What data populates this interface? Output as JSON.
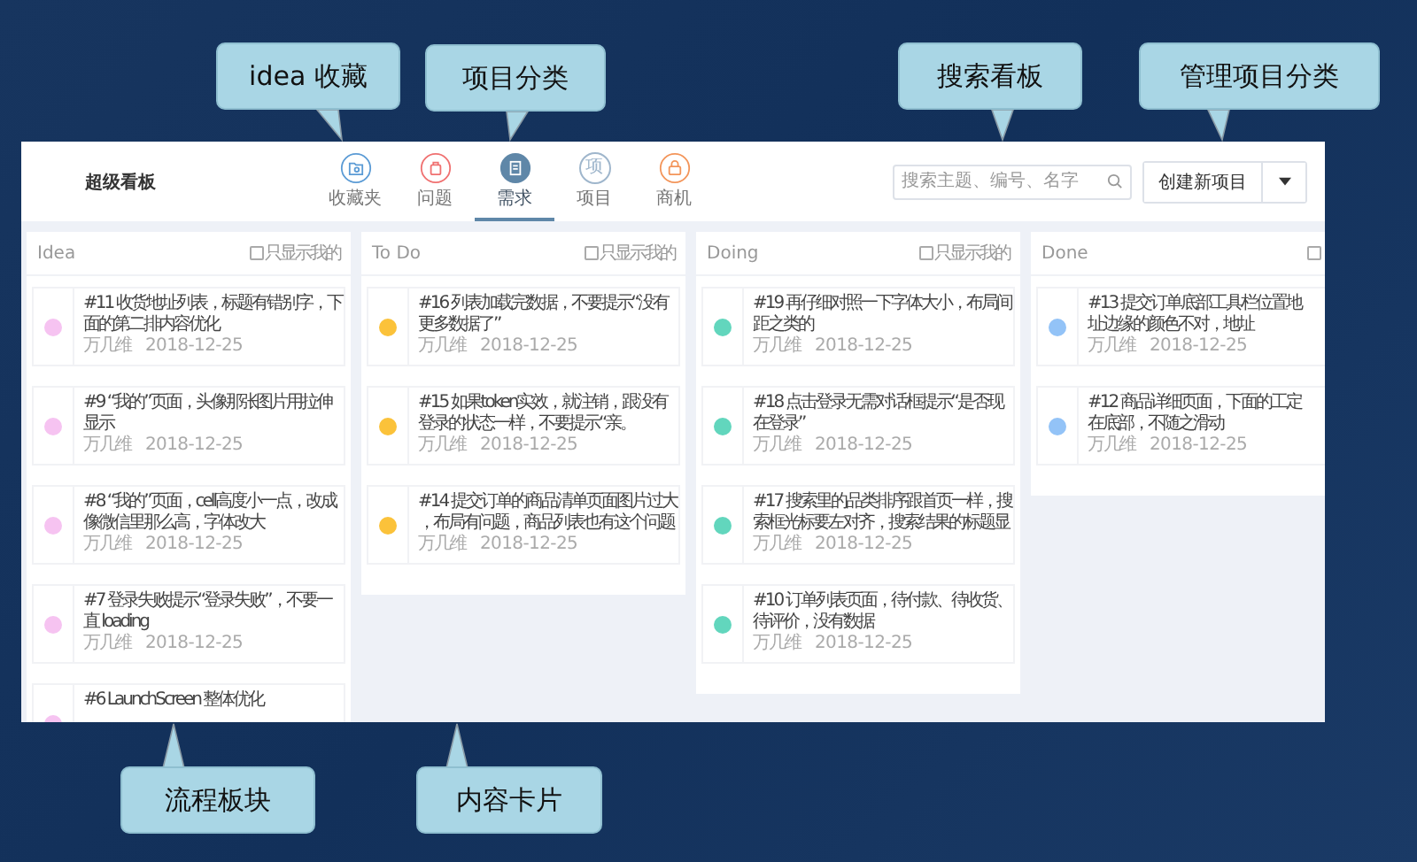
{
  "app": {
    "title": "超级看板",
    "tabs": [
      {
        "label": "收藏夹",
        "kind": "folder",
        "color": "#5b9bd5",
        "selected": false
      },
      {
        "label": "问题",
        "kind": "bag",
        "color": "#f07070",
        "selected": false
      },
      {
        "label": "需求",
        "kind": "doc",
        "color": "#5f87a8",
        "selected": true
      },
      {
        "label": "项目",
        "kind": "glyph",
        "glyph": "项",
        "color": "#9fb6cc",
        "selected": false
      },
      {
        "label": "商机",
        "kind": "lock",
        "color": "#f3955a",
        "selected": false
      }
    ],
    "search": {
      "placeholder": "搜索主题、编号、名字"
    },
    "create_button": "创建新项目"
  },
  "columns": [
    {
      "name": "Idea",
      "filter_label": "只显示我的",
      "filter_checked": false,
      "cards": [
        {
          "color": "#f6c3f1",
          "title": "#11 收货地址列表，标题有错别字，下面的第二排内容优化",
          "author": "万几维",
          "date": "2018-12-25"
        },
        {
          "color": "#f6c3f1",
          "title": "#9 “我的”页面，头像那张图片用拉伸显示",
          "author": "万几维",
          "date": "2018-12-25"
        },
        {
          "color": "#f6c3f1",
          "title": "#8 “我的”页面，cell高度小一点，改成像微信里那么高，字体改大",
          "author": "万几维",
          "date": "2018-12-25"
        },
        {
          "color": "#f6c3f1",
          "title": "#7 登录失败提示“登录失败”，不要一直 loading",
          "author": "万几维",
          "date": "2018-12-25"
        },
        {
          "color": "#f6c3f1",
          "title": "#6 LaunchScreen 整体优化"
        }
      ]
    },
    {
      "name": "To Do",
      "filter_label": "只显示我的",
      "filter_checked": false,
      "cards": [
        {
          "color": "#fbc23a",
          "title": "#16 列表加载完数据，不要提示“没有更多数据了”",
          "author": "万几维",
          "date": "2018-12-25"
        },
        {
          "color": "#fbc23a",
          "title": "#15 如果token实效，就注销，跟没有登录的状态一样，不要提示“亲。",
          "author": "万几维",
          "date": "2018-12-25"
        },
        {
          "color": "#fbc23a",
          "title": "#14 提交订单的商品清单页面图片过大，布局有问题，商品列表也有这个问题",
          "author": "万几维",
          "date": "2018-12-25"
        }
      ]
    },
    {
      "name": "Doing",
      "filter_label": "只显示我的",
      "filter_checked": false,
      "cards": [
        {
          "color": "#62d6bd",
          "title": "#19 再仔细对照一下字体大小，布局间距之类的",
          "author": "万几维",
          "date": "2018-12-25"
        },
        {
          "color": "#62d6bd",
          "title": "#18 点击登录无需对话框提示“是否现在登录”",
          "author": "万几维",
          "date": "2018-12-25"
        },
        {
          "color": "#62d6bd",
          "title": "#17 搜索里的品类排序跟首页一样，搜索框光标要左对齐，搜索结果的标题显",
          "author": "万几维",
          "date": "2018-12-25"
        },
        {
          "color": "#62d6bd",
          "title": "#10 订单列表页面，待付款、待收货、待评价，没有数据",
          "author": "万几维",
          "date": "2018-12-25"
        }
      ]
    },
    {
      "name": "Done",
      "filter_checked": false,
      "cards": [
        {
          "color": "#93c3f7",
          "title": "#13 提交订单底部工具栏位置地址边缘的颜色不对，地址",
          "author": "万几维",
          "date": "2018-12-25"
        },
        {
          "color": "#93c3f7",
          "title": "#12 商品详细页面，下面的工定在底部，不随之滑动",
          "author": "万几维",
          "date": "2018-12-25"
        }
      ]
    }
  ],
  "callouts": [
    {
      "text": "idea 收藏"
    },
    {
      "text": "项目分类"
    },
    {
      "text": "搜索看板"
    },
    {
      "text": "管理项目分类"
    },
    {
      "text": "流程板块"
    },
    {
      "text": "内容卡片"
    }
  ]
}
